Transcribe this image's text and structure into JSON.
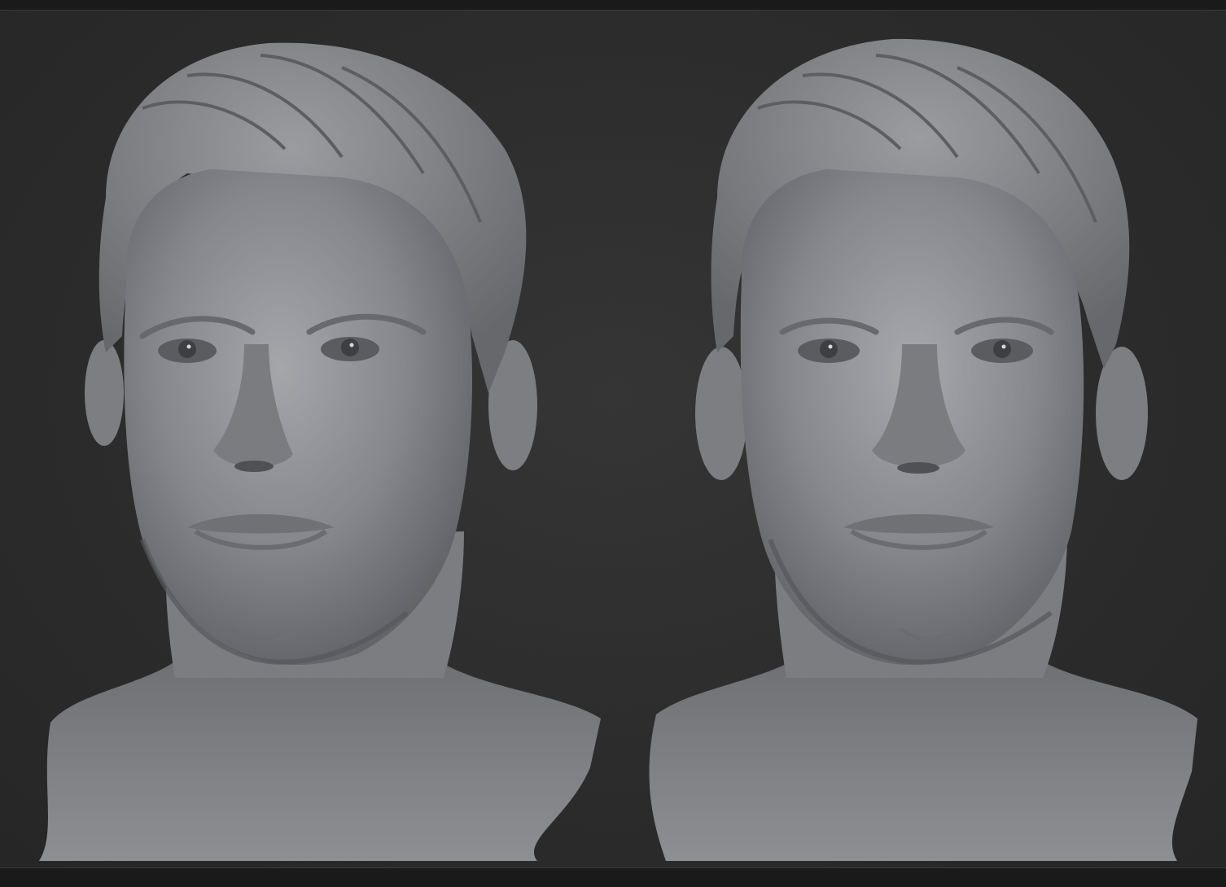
{
  "viewport": {
    "panels": [
      {
        "id": "left",
        "subject": "sculpted-male-head-bust"
      },
      {
        "id": "right",
        "subject": "sculpted-male-head-bust"
      }
    ],
    "background_color": "#2e2e2e",
    "material_color": "#8a8c90"
  }
}
